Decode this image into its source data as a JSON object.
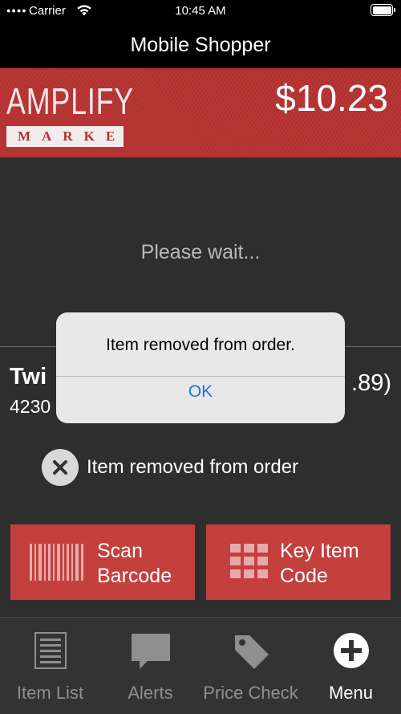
{
  "status_bar": {
    "carrier": "Carrier",
    "time": "10:45 AM"
  },
  "nav": {
    "title": "Mobile Shopper"
  },
  "banner": {
    "brand": "AMPLIFY",
    "sub": "MARKET",
    "total": "$10.23",
    "color": "#b33232"
  },
  "content": {
    "wait_text": "Please wait...",
    "item_name": "Twi",
    "item_code": "4230",
    "item_price": ".89)",
    "removed_label": "Item removed from order"
  },
  "actions": {
    "scan_line1": "Scan",
    "scan_line2": "Barcode",
    "key_line1": "Key Item",
    "key_line2": "Code",
    "color": "#c3403f"
  },
  "tabs": [
    {
      "label": "Item List",
      "icon": "list-icon"
    },
    {
      "label": "Alerts",
      "icon": "chat-bubble-icon"
    },
    {
      "label": "Price Check",
      "icon": "price-tag-icon"
    },
    {
      "label": "Menu",
      "icon": "plus-circle-icon",
      "active": true
    }
  ],
  "alert": {
    "title": "Item removed from order.",
    "ok_label": "OK",
    "accent": "#1a73e8"
  }
}
